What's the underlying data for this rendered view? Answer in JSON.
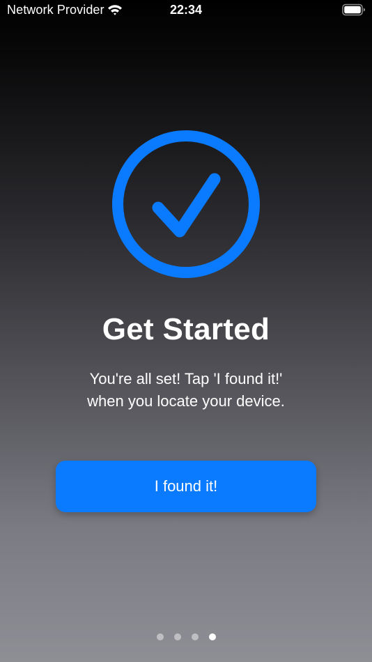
{
  "status_bar": {
    "carrier": "Network Provider",
    "time": "22:34",
    "wifi_icon": "wifi-icon",
    "battery_icon": "battery-icon",
    "battery_level": 1.0
  },
  "hero": {
    "icon": "checkmark-circle-icon",
    "icon_color": "#0a7aff"
  },
  "content": {
    "title": "Get Started",
    "subtitle_line1": "You're all set! Tap 'I found it!'",
    "subtitle_line2": "when you locate your device."
  },
  "actions": {
    "primary_label": "I found it!",
    "primary_color": "#0a7aff"
  },
  "pagination": {
    "total": 4,
    "current": 4
  }
}
